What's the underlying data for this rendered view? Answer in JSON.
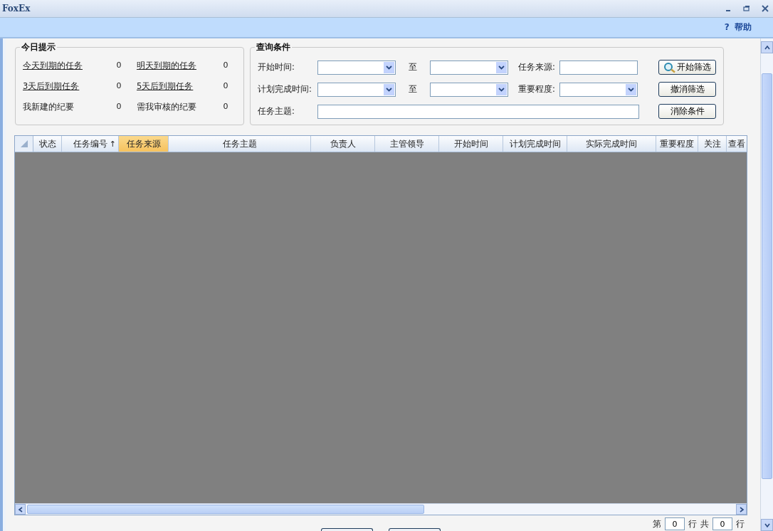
{
  "window": {
    "title": "FoxEx"
  },
  "toolbar": {
    "help_icon": "?",
    "help": "帮助"
  },
  "today_panel": {
    "title": "今日提示",
    "items": [
      {
        "label": "今天到期的任务",
        "count": "0",
        "link": true
      },
      {
        "label": "明天到期的任务",
        "count": "0",
        "link": true
      },
      {
        "label": "3天后到期任务",
        "count": "0",
        "link": true
      },
      {
        "label": "5天后到期任务",
        "count": "0",
        "link": true
      },
      {
        "label": "我新建的纪要",
        "count": "0",
        "link": false
      },
      {
        "label": "需我审核的纪要",
        "count": "0",
        "link": false
      }
    ]
  },
  "query_panel": {
    "title": "查询条件",
    "rows": [
      {
        "kind": "range",
        "label": "开始时间:",
        "sep": "至",
        "extra": {
          "label": "任务来源:",
          "kind": "text"
        },
        "button": {
          "label": "开始筛选",
          "kind": "search"
        }
      },
      {
        "kind": "range",
        "label": "计划完成时间:",
        "sep": "至",
        "extra": {
          "label": "重要程度:",
          "kind": "dropdown"
        },
        "button": {
          "label": "撤消筛选",
          "kind": "plain"
        }
      },
      {
        "kind": "text",
        "label": "任务主题:",
        "button": {
          "label": "消除条件",
          "kind": "plain"
        }
      }
    ]
  },
  "table": {
    "columns": [
      {
        "label": "状态",
        "selected": false
      },
      {
        "label": "任务编号",
        "selected": false,
        "sort_mark": "↑"
      },
      {
        "label": "任务来源",
        "selected": true
      },
      {
        "label": "任务主题",
        "selected": false
      },
      {
        "label": "负责人",
        "selected": false
      },
      {
        "label": "主管领导",
        "selected": false
      },
      {
        "label": "开始时间",
        "selected": false
      },
      {
        "label": "计划完成时间",
        "selected": false
      },
      {
        "label": "实际完成时间",
        "selected": false
      },
      {
        "label": "重要程度",
        "selected": false
      },
      {
        "label": "关注",
        "selected": false
      },
      {
        "label": "查看",
        "selected": false
      }
    ]
  },
  "pager": {
    "prefix": "第",
    "row_value": "0",
    "row_unit": "行",
    "total_prefix": "共",
    "total_value": "0",
    "total_unit": "行"
  }
}
